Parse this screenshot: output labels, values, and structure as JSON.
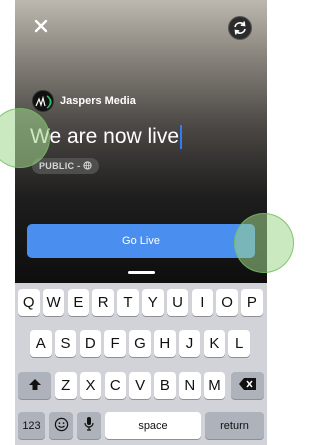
{
  "header": {
    "close_icon": "close-icon",
    "flip_icon": "camera-flip-icon"
  },
  "broadcast": {
    "page_name": "Jaspers Media",
    "title": "We are now live",
    "privacy": "PUBLIC -",
    "privacy_icon": "globe-icon"
  },
  "actions": {
    "go_live_label": "Go Live",
    "go_live_color": "#4a8ff0"
  },
  "keyboard": {
    "row1": [
      "Q",
      "W",
      "E",
      "R",
      "T",
      "Y",
      "U",
      "I",
      "O",
      "P"
    ],
    "row2": [
      "A",
      "S",
      "D",
      "F",
      "G",
      "H",
      "J",
      "K",
      "L"
    ],
    "row3": [
      "Z",
      "X",
      "C",
      "V",
      "B",
      "N",
      "M"
    ],
    "numbers_label": "123",
    "space_label": "space",
    "return_label": "return",
    "shift_icon": "shift-icon",
    "delete_icon": "backspace-icon",
    "emoji_icon": "emoji-icon",
    "mic_icon": "microphone-icon"
  }
}
